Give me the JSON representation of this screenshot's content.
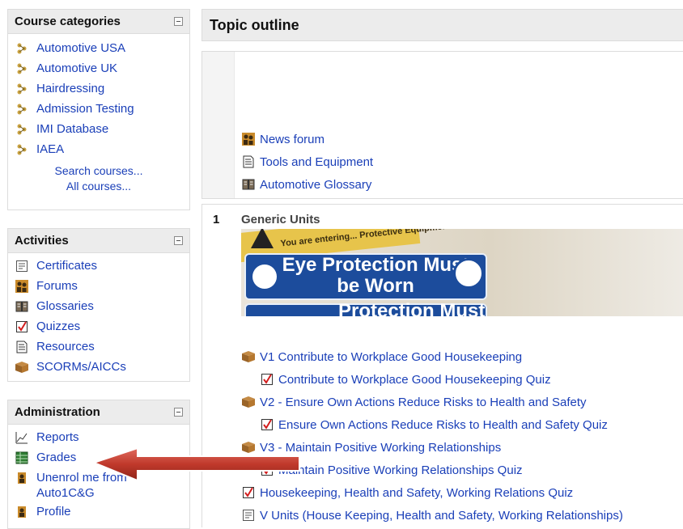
{
  "course_categories": {
    "title": "Course categories",
    "items": [
      {
        "label": "Automotive USA"
      },
      {
        "label": "Automotive UK"
      },
      {
        "label": "Hairdressing"
      },
      {
        "label": "Admission Testing"
      },
      {
        "label": "IMI Database"
      },
      {
        "label": "IAEA"
      }
    ],
    "search_link": "Search courses...",
    "all_link": "All courses..."
  },
  "activities": {
    "title": "Activities",
    "items": [
      {
        "label": "Certificates",
        "icon": "certificate-icon"
      },
      {
        "label": "Forums",
        "icon": "forum-icon"
      },
      {
        "label": "Glossaries",
        "icon": "glossary-icon"
      },
      {
        "label": "Quizzes",
        "icon": "quiz-icon"
      },
      {
        "label": "Resources",
        "icon": "resource-icon"
      },
      {
        "label": "SCORMs/AICCs",
        "icon": "scorm-package-icon"
      }
    ]
  },
  "administration": {
    "title": "Administration",
    "items": [
      {
        "label": "Reports",
        "icon": "reports-chart-icon"
      },
      {
        "label": "Grades",
        "icon": "grades-grid-icon"
      },
      {
        "label": "Unenrol me from Auto1C&G",
        "icon": "unenrol-icon"
      },
      {
        "label": "Profile",
        "icon": "profile-icon"
      }
    ]
  },
  "main": {
    "title": "Topic outline",
    "section0": {
      "activities": [
        {
          "label": "News forum",
          "icon": "forum-icon"
        },
        {
          "label": "Tools and Equipment",
          "icon": "resource-icon"
        },
        {
          "label": "Automotive Glossary",
          "icon": "glossary-icon"
        }
      ]
    },
    "section1": {
      "number": "1",
      "title": "Generic Units",
      "banner": {
        "small_text": "You are entering... Protective Equipment Must",
        "sign_text_1": "Eye Protection Must",
        "sign_text_2": "be Worn",
        "sign_text_3": "Protection Must"
      },
      "activities": [
        {
          "label": "V1 Contribute to Workplace Good Housekeeping",
          "icon": "scorm-package-icon",
          "indent": 0
        },
        {
          "label": "Contribute to Workplace Good Housekeeping Quiz",
          "icon": "quiz-icon",
          "indent": 1
        },
        {
          "label": "V2 - Ensure Own Actions Reduce Risks to Health and Safety",
          "icon": "scorm-package-icon",
          "indent": 0
        },
        {
          "label": "Ensure Own Actions Reduce Risks to Health and Safety Quiz",
          "icon": "quiz-icon",
          "indent": 1
        },
        {
          "label": "V3 - Maintain Positive Working Relationships",
          "icon": "scorm-package-icon",
          "indent": 0
        },
        {
          "label": "Maintain Positive Working Relationships Quiz",
          "icon": "quiz-icon",
          "indent": 1
        },
        {
          "label": "Housekeeping, Health and Safety, Working Relations Quiz",
          "icon": "quiz-icon",
          "indent": 0
        },
        {
          "label": "V Units (House Keeping, Health and Safety, Working Relationships)",
          "icon": "certificate-icon",
          "indent": 0
        }
      ]
    }
  },
  "annotation": {
    "type": "red-arrow",
    "points_to": "Grades"
  },
  "colors": {
    "link": "#1a3fb8",
    "header_bg": "#ececec",
    "arrow": "#c0392b"
  }
}
